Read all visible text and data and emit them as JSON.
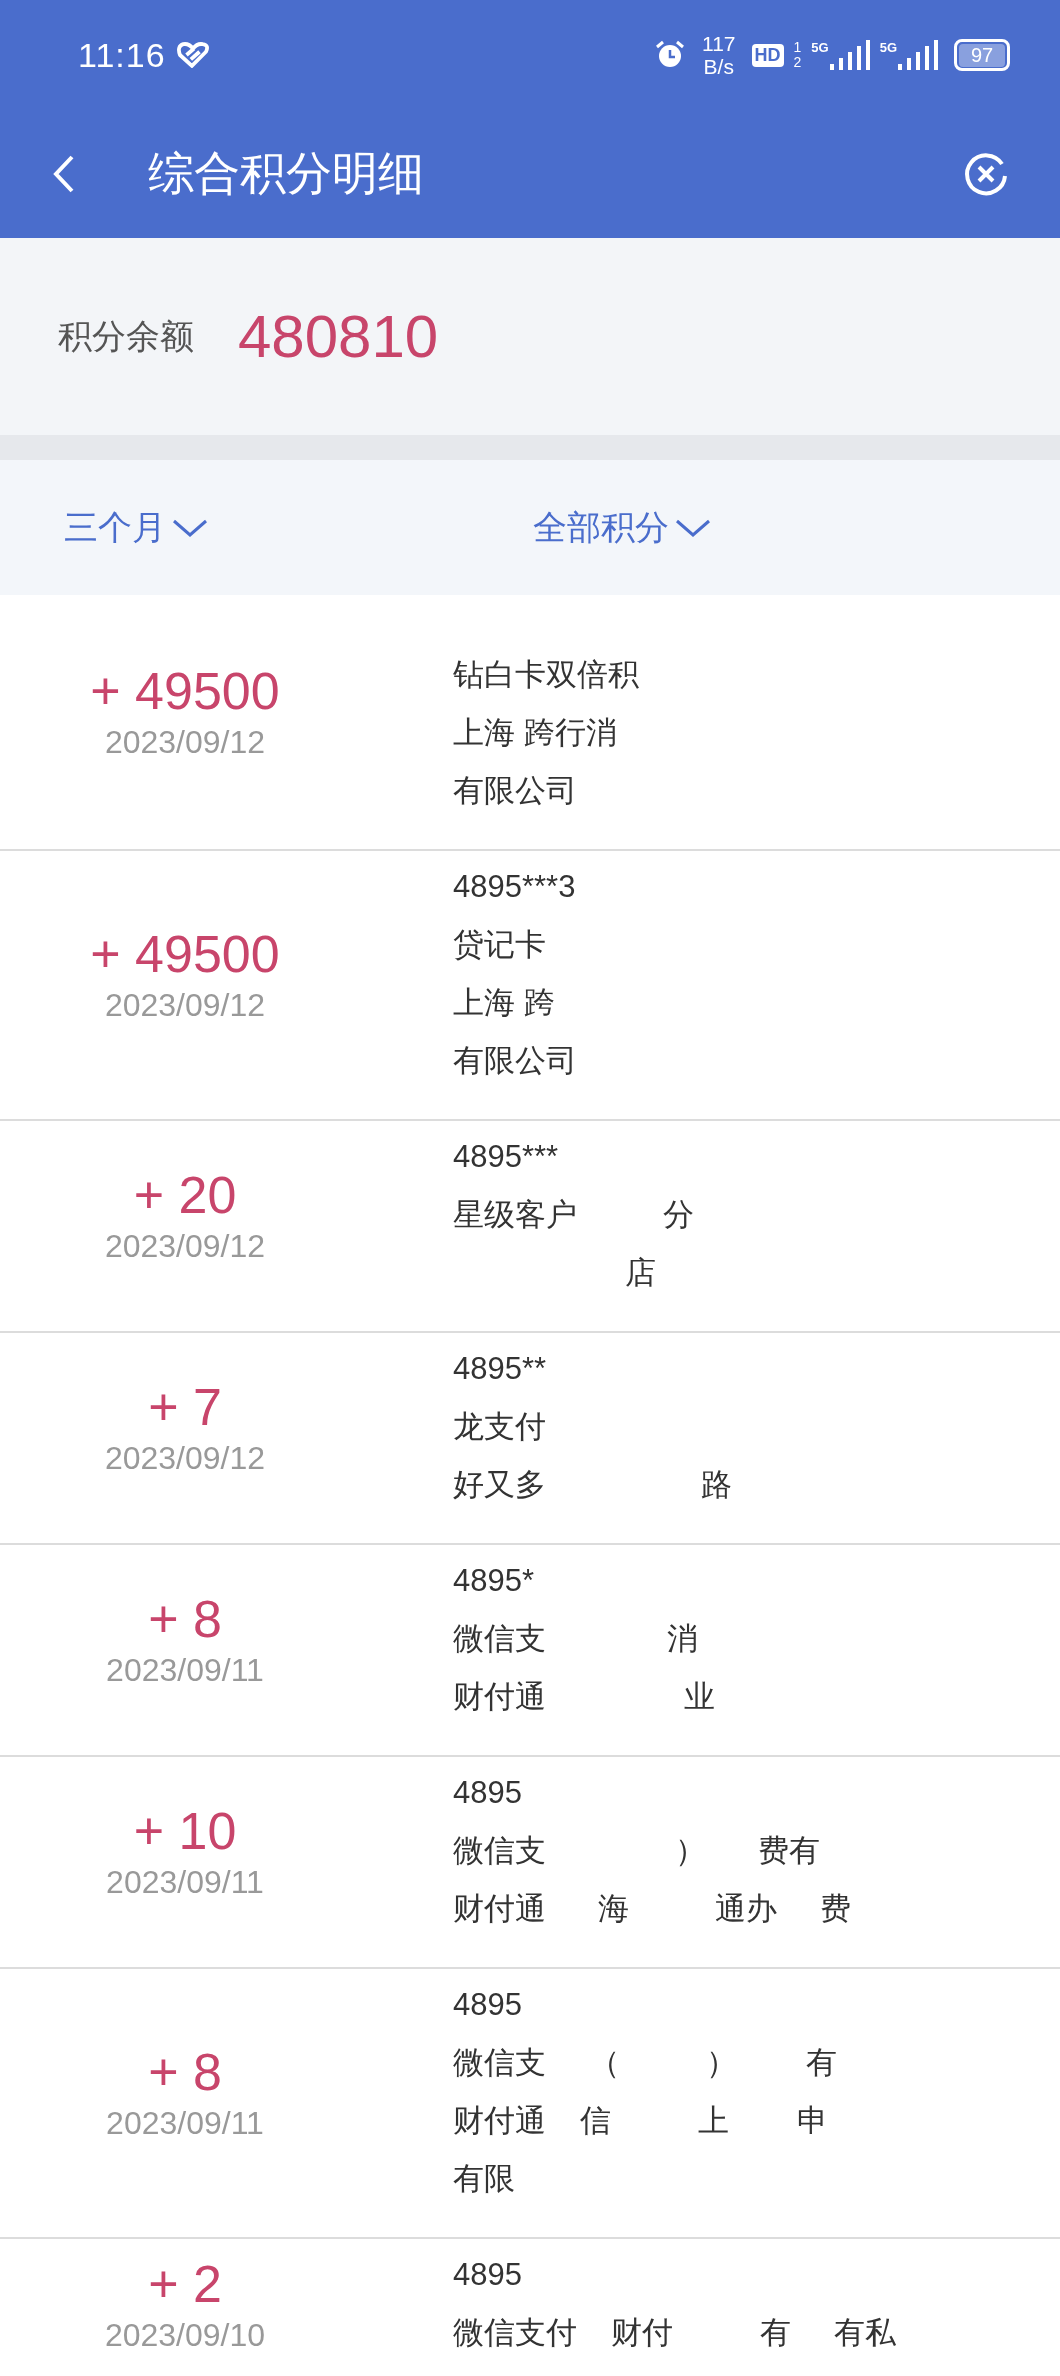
{
  "status_bar": {
    "time": "11:16",
    "speed_value": "117",
    "speed_unit": "B/s",
    "hd_badge": "HD",
    "sim_slots": [
      "1",
      "2"
    ],
    "networks": [
      "5G",
      "5G"
    ],
    "battery": "97"
  },
  "header": {
    "title": "综合积分明细"
  },
  "balance": {
    "label": "积分余额",
    "value": "480810"
  },
  "filters": [
    {
      "label": "三个月"
    },
    {
      "label": "全部积分"
    }
  ],
  "records": [
    {
      "points": "+ 49500",
      "date": "2023/09/12",
      "lines": [
        "钻白卡双倍积",
        "上海 跨行消",
        "有限公司"
      ]
    },
    {
      "points": "+ 49500",
      "date": "2023/09/12",
      "card": "4895***3",
      "lines": [
        "贷记卡",
        "上海 跨",
        "有限公司"
      ]
    },
    {
      "points": "+ 20",
      "date": "2023/09/12",
      "card": "4895***",
      "lines": [
        "星级客户          分",
        "                    店"
      ]
    },
    {
      "points": "+ 7",
      "date": "2023/09/12",
      "card": "4895**",
      "lines": [
        "龙支付",
        "好又多                  路"
      ]
    },
    {
      "points": "+ 8",
      "date": "2023/09/11",
      "card": "4895*",
      "lines": [
        "微信支              消",
        "财付通                业"
      ]
    },
    {
      "points": "+ 10",
      "date": "2023/09/11",
      "card": "4895",
      "lines": [
        "微信支               ）      费有",
        "财付通      海          通办     费"
      ]
    },
    {
      "points": "+ 8",
      "date": "2023/09/11",
      "card": "4895",
      "lines": [
        "微信支     （          ）        有",
        "财付通    信          上        申",
        "有限"
      ]
    },
    {
      "points": "+ 2",
      "date": "2023/09/10",
      "card": "4895",
      "lines": [
        "微信支付    财付          有     有私"
      ]
    }
  ]
}
